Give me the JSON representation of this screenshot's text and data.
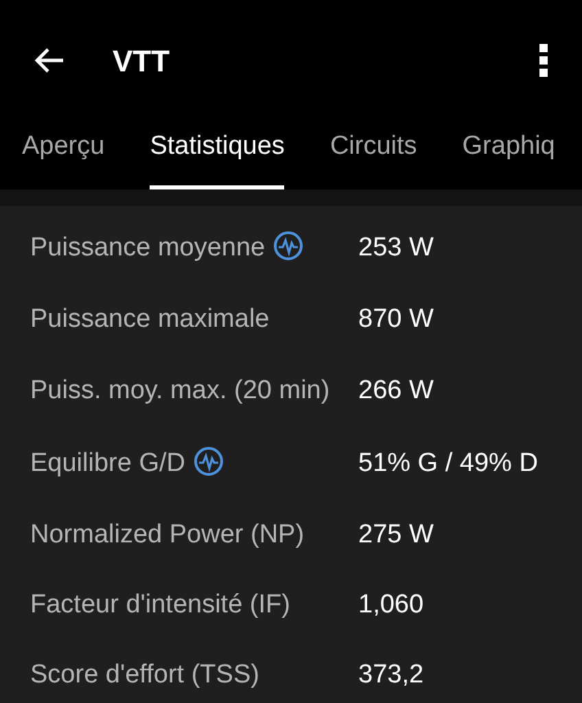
{
  "app_bar": {
    "title": "VTT"
  },
  "tabs": [
    {
      "label": "Aperçu",
      "selected": false
    },
    {
      "label": "Statistiques",
      "selected": true
    },
    {
      "label": "Circuits",
      "selected": false
    },
    {
      "label": "Graphiq",
      "selected": false
    }
  ],
  "stats": [
    {
      "label": "Puissance moyenne",
      "value": "253 W",
      "has_chart_icon": true
    },
    {
      "label": "Puissance maximale",
      "value": "870 W",
      "has_chart_icon": false
    },
    {
      "label": "Puiss. moy. max. (20 min)",
      "value": "266 W",
      "has_chart_icon": false
    },
    {
      "label": "Equilibre G/D",
      "value": "51% G / 49% D",
      "has_chart_icon": true
    },
    {
      "label": "Normalized Power (NP)",
      "value": "275 W",
      "has_chart_icon": false
    },
    {
      "label": "Facteur d'intensité (IF)",
      "value": "1,060",
      "has_chart_icon": false
    },
    {
      "label": "Score d'effort (TSS)",
      "value": "373,2",
      "has_chart_icon": false
    }
  ]
}
